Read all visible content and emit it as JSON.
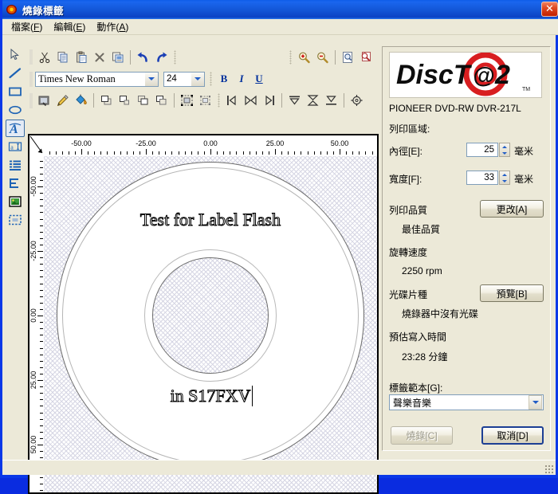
{
  "window": {
    "title": "燒錄標籤",
    "icon": "disc-icon",
    "close_label": "✕"
  },
  "menu": [
    {
      "name": "file",
      "text": "檔案",
      "accel": "F"
    },
    {
      "name": "edit",
      "text": "編輯",
      "accel": "E"
    },
    {
      "name": "action",
      "text": "動作",
      "accel": "A"
    }
  ],
  "left_tools": [
    {
      "name": "pointer-tool",
      "icon": "cursor-arrow-icon",
      "selected": false
    },
    {
      "name": "line-tool",
      "icon": "line-icon",
      "selected": false
    },
    {
      "name": "rectangle-tool",
      "icon": "rectangle-icon",
      "selected": false
    },
    {
      "name": "ellipse-tool",
      "icon": "ellipse-icon",
      "selected": false
    },
    {
      "name": "arc-text-tool",
      "icon": "curved-text-a-icon",
      "selected": true
    },
    {
      "name": "text-box-tool",
      "icon": "text-field-icon",
      "selected": false
    },
    {
      "name": "list-text-tool",
      "icon": "paragraph-lines-icon",
      "selected": false
    },
    {
      "name": "vertical-text-tool",
      "icon": "vertical-text-icon",
      "selected": false
    },
    {
      "name": "image-tool",
      "icon": "picture-icon",
      "selected": false
    },
    {
      "name": "marquee-tool",
      "icon": "dashed-select-icon",
      "selected": false
    }
  ],
  "toolbar_row1": [
    {
      "name": "cut-button",
      "icon": "scissors-icon"
    },
    {
      "name": "copy-button",
      "icon": "copy-pages-icon"
    },
    {
      "name": "paste-button",
      "icon": "clipboard-icon"
    },
    {
      "name": "delete-button",
      "icon": "x-cross-icon"
    },
    {
      "name": "duplicate-button",
      "icon": "duplicate-icon"
    },
    {
      "name": "undo-button",
      "icon": "undo-arrow-icon"
    },
    {
      "name": "redo-button",
      "icon": "redo-arrow-icon"
    }
  ],
  "toolbar_row1_right": [
    {
      "name": "zoom-in-button",
      "icon": "magnifier-plus-icon"
    },
    {
      "name": "zoom-out-button",
      "icon": "magnifier-minus-icon"
    },
    {
      "name": "zoom-page-button",
      "icon": "page-zoom-icon"
    },
    {
      "name": "zoom-area-button",
      "icon": "area-zoom-icon"
    }
  ],
  "font_bar": {
    "font_name": "Times New Roman",
    "font_size": "24",
    "bold_label": "B",
    "italic_label": "I",
    "underline_label": "U",
    "bold_name": "bold-button",
    "italic_name": "italic-button",
    "underline_name": "underline-button"
  },
  "toolbar_row3": [
    {
      "name": "select-object-button",
      "icon": "select-object-icon"
    },
    {
      "name": "pencil-button",
      "icon": "pencil-icon"
    },
    {
      "name": "fill-color-button",
      "icon": "paint-bucket-icon"
    },
    {
      "name": "bring-to-front-button",
      "icon": "bring-front-icon"
    },
    {
      "name": "bring-forward-button",
      "icon": "bring-forward-icon"
    },
    {
      "name": "send-backward-button",
      "icon": "send-backward-icon"
    },
    {
      "name": "send-to-back-button",
      "icon": "send-back-icon"
    },
    {
      "name": "group-button",
      "icon": "group-icon"
    },
    {
      "name": "ungroup-button",
      "icon": "ungroup-icon"
    }
  ],
  "toolbar_row3_right": [
    {
      "name": "align-left-edge-button",
      "icon": "align-start-icon"
    },
    {
      "name": "align-center-h-button",
      "icon": "align-center-h-icon"
    },
    {
      "name": "align-right-edge-button",
      "icon": "align-end-icon"
    },
    {
      "name": "align-top-button",
      "icon": "align-top-icon"
    },
    {
      "name": "align-middle-button",
      "icon": "align-middle-icon"
    },
    {
      "name": "align-bottom-button",
      "icon": "align-bottom-icon"
    },
    {
      "name": "center-on-disc-button",
      "icon": "center-disc-icon"
    }
  ],
  "canvas": {
    "ruler_h_labels": [
      "-50.00",
      "-25.00",
      "0.00",
      "25.00",
      "50.00"
    ],
    "ruler_v_labels": [
      "-50.00",
      "-25.00",
      "0.00",
      "25.00",
      "50.00"
    ],
    "texts": [
      {
        "name": "label-text-top",
        "value": "Test for Label Flash"
      },
      {
        "name": "label-text-bottom",
        "value": "in S17FXV"
      }
    ]
  },
  "right_panel": {
    "logo_text": "DiscT@2",
    "logo_tm": "TM",
    "drive": "PIONEER DVD-RW  DVR-217L",
    "print_area_label": "列印區域:",
    "inner_diameter": {
      "label": "內徑[E]:",
      "accel": "E",
      "value": "25",
      "unit": "毫米"
    },
    "width": {
      "label": "寬度[F]:",
      "accel": "F",
      "value": "33",
      "unit": "毫米"
    },
    "print_quality": {
      "label": "列印品質",
      "value": "最佳品質",
      "button": "更改[A]",
      "button_accel": "A"
    },
    "rotation_speed": {
      "label": "旋轉速度",
      "value": "2250 rpm"
    },
    "disc_type": {
      "label": "光碟片種",
      "value": "燒錄器中沒有光碟",
      "button": "預覽[B]",
      "button_accel": "B"
    },
    "estimated_time": {
      "label": "預估寫入時間",
      "value": "23:28 分鐘"
    },
    "template": {
      "label": "標籤範本[G]:",
      "accel": "G",
      "value": "聲樂音樂"
    },
    "burn_button": {
      "label": "燒錄[C]",
      "accel": "C",
      "enabled": false
    },
    "cancel_button": {
      "label": "取消[D]",
      "accel": "D",
      "enabled": true
    }
  },
  "colors": {
    "window_frame": "#0a38e8",
    "panel_bg": "#ece9d8",
    "title_gradient_start": "#1a66ee",
    "close_red": "#c02000",
    "accent_blue": "#215dc6",
    "logo_red": "#d81e20"
  }
}
